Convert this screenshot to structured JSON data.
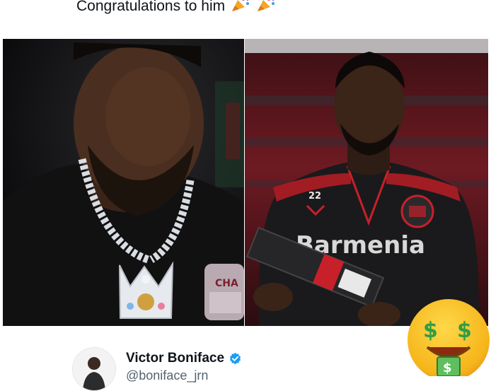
{
  "post": {
    "caption": "Congratulations to him",
    "caption_emojis": [
      "party-popper-icon",
      "party-popper-icon"
    ]
  },
  "photos": {
    "left": {
      "alt": "man in black t-shirt with crown pendant chain"
    },
    "right": {
      "alt": "footballer in black Bayer Leverkusen training top holding award",
      "shirt_number": "22",
      "sponsor": "Barmenia"
    }
  },
  "profile": {
    "name": "Victor Boniface",
    "handle": "@boniface_jrn",
    "verified": true,
    "verified_color": "#1d9bf0"
  },
  "overlay_emoji": "money-mouth-face-icon"
}
